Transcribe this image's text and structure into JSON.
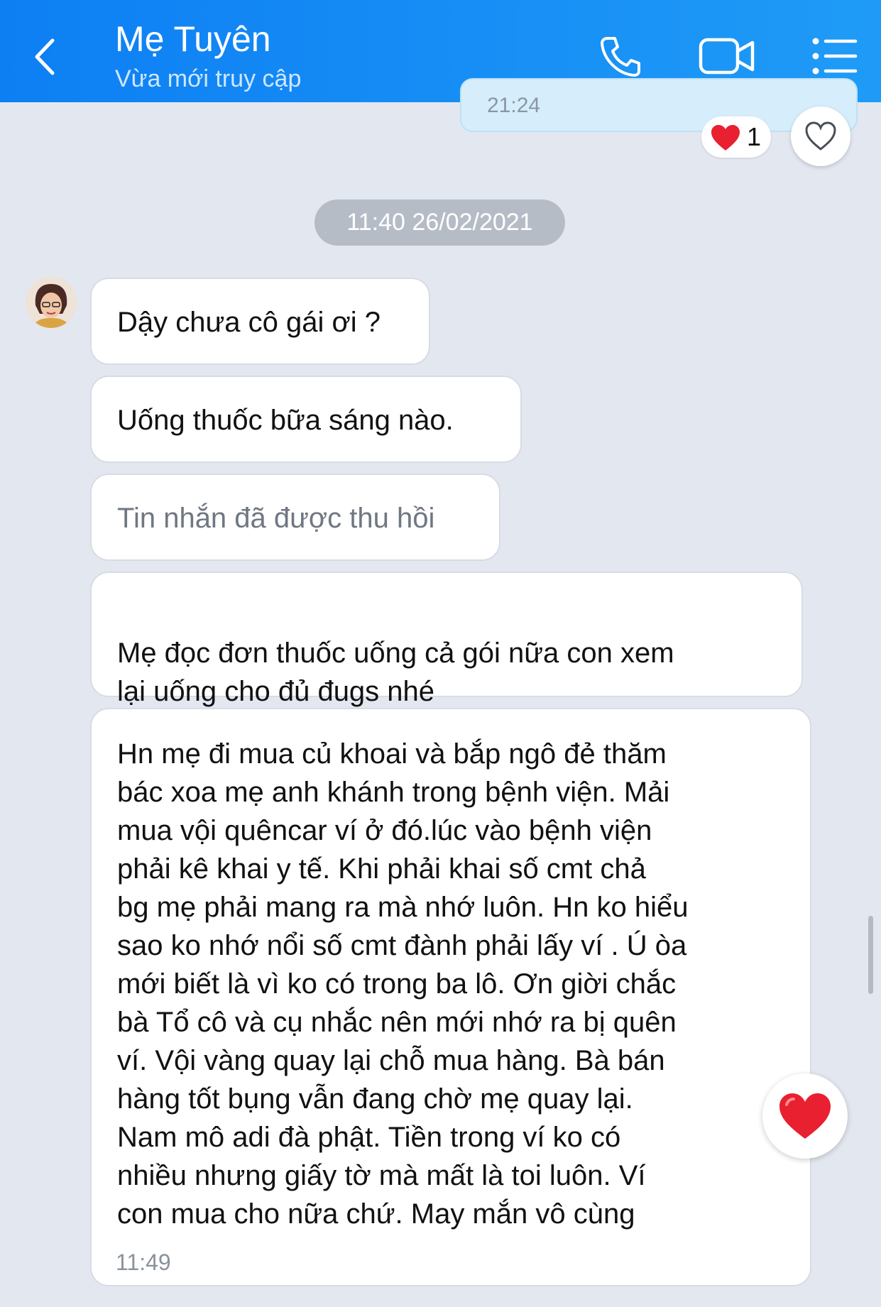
{
  "header": {
    "title": "Mẹ Tuyên",
    "subtitle": "Vừa mới truy cập",
    "icons": [
      "back-chevron-icon",
      "phone-icon",
      "video-call-icon",
      "menu-list-icon"
    ],
    "background": "#1a8ff5"
  },
  "previous_message": {
    "time": "21:24",
    "reaction": {
      "emoji": "heart",
      "count": "1"
    }
  },
  "date_separator": "11:40 26/02/2021",
  "messages": [
    {
      "text": "Dậy chưa cô gái ơi ?"
    },
    {
      "text": "Uống thuốc bữa sáng nào."
    },
    {
      "text": "Tin nhắn đã được thu hồi",
      "recalled": true
    },
    {
      "text": "Mẹ đọc đơn thuốc uống cả gói nữa con xem\nlại uống  cho đủ đugs nhé"
    },
    {
      "text": "Hn mẹ đi mua củ khoai và bắp ngô đẻ thăm\nbác xoa mẹ anh khánh trong bệnh viện. Mải\nmua vội quêncar ví ở đó.lúc vào bệnh viện\nphải kê khai y tế. Khi phải khai số cmt chả\nbg mẹ phải mang ra mà nhớ luôn. Hn ko hiểu\nsao ko nhớ nổi số cmt đành phải lấy ví . Ú òa\nmới biết là vì ko có trong ba lô. Ơn giời chắc\nbà Tổ cô và cụ nhắc nên mới nhớ ra bị quên\nví. Vội vàng quay lại chỗ mua hàng. Bà bán\nhàng tốt bụng vẫn đang chờ mẹ quay lại.\nNam mô adi đà phật. Tiền trong ví ko có\nnhiều nhưng giấy tờ mà mất là toi luôn. Ví\ncon mua cho nữa chứ. May mắn vô cùng",
      "time": "11:49",
      "reaction": "heart"
    }
  ],
  "colors": {
    "chat_background": "#e3e7ef",
    "outgoing_bubble": "#d6eefc",
    "reaction_heart": "#e8202f"
  }
}
